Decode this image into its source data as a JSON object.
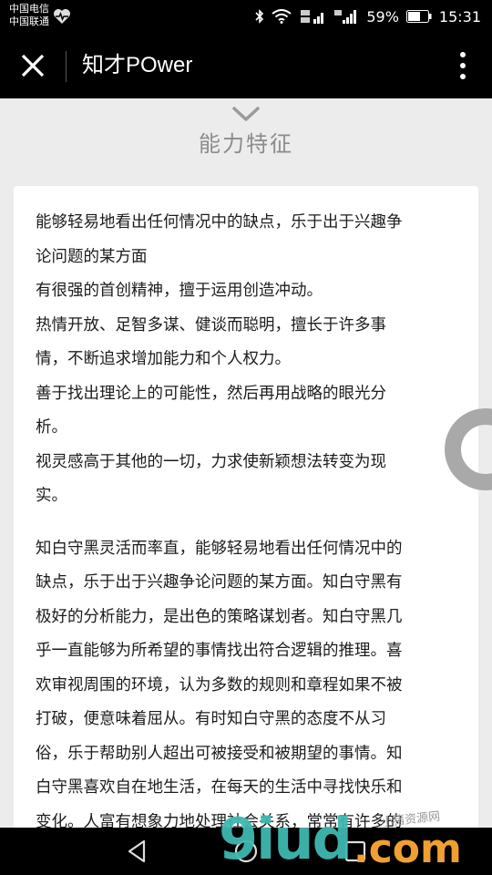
{
  "status_bar": {
    "carrier_1": "中国电信",
    "carrier_2": "中国联通",
    "battery": "59%",
    "time": "15:31",
    "icons": [
      "heart-icon",
      "bluetooth-icon",
      "wifi-icon",
      "signal-4g-icon",
      "signal-2g-icon",
      "battery-icon"
    ]
  },
  "app_bar": {
    "title": "知才POwer",
    "close_icon": "close-icon",
    "menu_icon": "more-vertical-icon"
  },
  "section": {
    "title": "能力特征",
    "chevron_icon": "chevron-down-icon"
  },
  "card": {
    "lines": [
      "能够轻易地看出任何情况中的缺点，乐于出于兴趣争",
      "论问题的某方面",
      "有很强的首创精神，擅于运用创造冲动。",
      "热情开放、足智多谋、健谈而聪明，擅长于许多事",
      "情，不断追求增加能力和个人权力。",
      "善于找出理论上的可能性，然后再用战略的眼光分",
      "析。",
      "视灵感高于其他的一切，力求使新颖想法转变为现",
      "实。"
    ],
    "description": [
      "知白守黑灵活而率直，能够轻易地看出任何情况中的",
      "缺点，乐于出于兴趣争论问题的某方面。知白守黑有",
      "极好的分析能力，是出色的策略谋划者。知白守黑几",
      "乎一直能够为所希望的事情找出符合逻辑的推理。喜",
      "欢审视周围的环境，认为多数的规则和章程如果不被",
      "打破，便意味着屈从。有时知白守黑的态度不从习",
      "俗，乐于帮助别人超出可被接受和被期望的事情。知",
      "白守黑喜欢自在地生活，在每天的生活中寻找快乐和",
      "变化。人富有想象力地处理社会关系，常常有许多的"
    ]
  },
  "nav_bar": {
    "icons": [
      "back-triangle-icon",
      "home-circle-icon",
      "recents-square-icon"
    ]
  },
  "watermark": {
    "main": "9iud",
    "suffix": ".com",
    "small": "小猪资源网"
  },
  "colors": {
    "bar_background": "#000000",
    "page_background": "#ececec",
    "card_background": "#ffffff",
    "section_title": "#8c8c8c",
    "body_text": "#1c1c1c",
    "loading_ring": "#a9a9a9",
    "watermark_teal": "#3fb9b0",
    "watermark_orange": "#f0a030"
  }
}
